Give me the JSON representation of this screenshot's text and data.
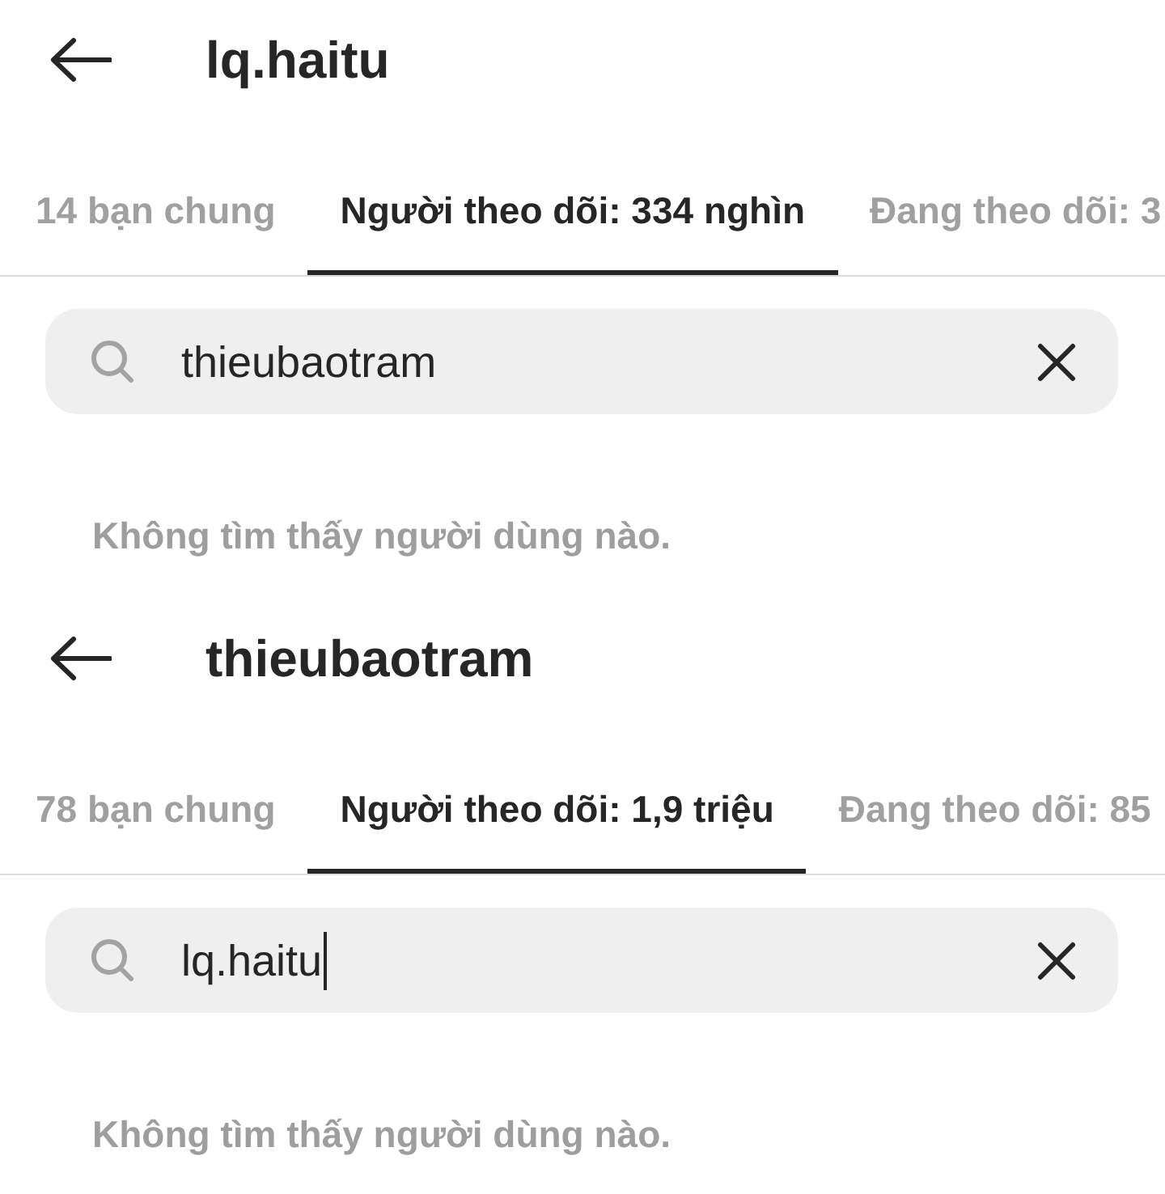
{
  "panels": [
    {
      "header": {
        "title": "lq.haitu"
      },
      "tabs": [
        {
          "label": "14 bạn chung",
          "selected": false
        },
        {
          "label": "Người theo dõi: 334 nghìn",
          "selected": true
        },
        {
          "label": "Đang theo dõi: 3",
          "selected": false
        }
      ],
      "search": {
        "value": "thieubaotram",
        "focused": false
      },
      "message": "Không tìm thấy người dùng nào."
    },
    {
      "header": {
        "title": "thieubaotram"
      },
      "tabs": [
        {
          "label": "78 bạn chung",
          "selected": false
        },
        {
          "label": "Người theo dõi: 1,9 triệu",
          "selected": true
        },
        {
          "label": "Đang theo dõi: 85",
          "selected": false
        }
      ],
      "search": {
        "value": "lq.haitu",
        "focused": true
      },
      "message": "Không tìm thấy người dùng nào."
    }
  ]
}
